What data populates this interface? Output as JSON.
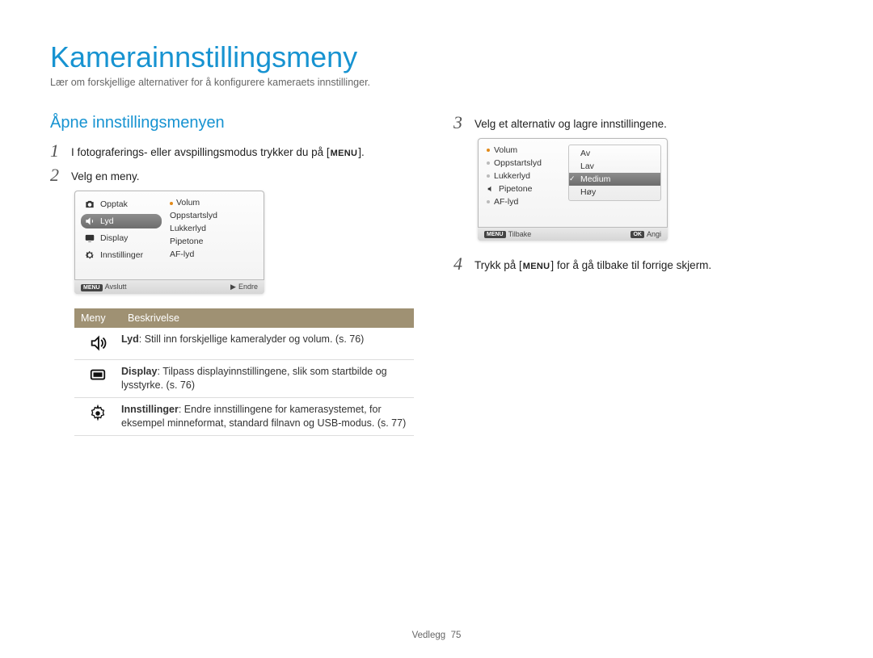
{
  "title": "Kamerainnstillingsmeny",
  "subtitle": "Lær om forskjellige alternativer for å konfigurere kameraets innstillinger.",
  "section_heading": "Åpne innstillingsmenyen",
  "steps": {
    "s1_pre": "I fotograferings- eller avspillingsmodus trykker du på [",
    "s1_btn": "MENU",
    "s1_post": "].",
    "s2": "Velg en meny.",
    "s3": "Velg et alternativ og lagre innstillingene.",
    "s4_pre": "Trykk på [",
    "s4_btn": "MENU",
    "s4_post": "] for å gå tilbake til forrige skjerm."
  },
  "lcd1": {
    "left": [
      "Opptak",
      "Lyd",
      "Display",
      "Innstillinger"
    ],
    "right": [
      "Volum",
      "Oppstartslyd",
      "Lukkerlyd",
      "Pipetone",
      "AF-lyd"
    ],
    "foot_left_badge": "MENU",
    "foot_left": "Avslutt",
    "foot_right_arrow": "▶",
    "foot_right": "Endre"
  },
  "lcd2": {
    "left": [
      "Volum",
      "Oppstartslyd",
      "Lukkerlyd",
      "Pipetone",
      "AF-lyd"
    ],
    "values": [
      "Av",
      "Lav",
      "Medium",
      "Høy"
    ],
    "selected": "Medium",
    "foot_left_badge": "MENU",
    "foot_left": "Tilbake",
    "foot_right_badge": "OK",
    "foot_right": "Angi"
  },
  "table": {
    "head_meny": "Meny",
    "head_besk": "Beskrivelse",
    "rows": [
      {
        "icon": "sound",
        "bold": "Lyd",
        "text": ": Still inn forskjellige kameralyder og volum. (s. 76)"
      },
      {
        "icon": "display",
        "bold": "Display",
        "text": ": Tilpass displayinnstillingene, slik som startbilde og lysstyrke. (s. 76)"
      },
      {
        "icon": "gear",
        "bold": "Innstillinger",
        "text": ": Endre innstillingene for kamerasystemet, for eksempel minneformat, standard filnavn og USB-modus. (s. 77)"
      }
    ]
  },
  "footer_label": "Vedlegg",
  "footer_page": "75"
}
